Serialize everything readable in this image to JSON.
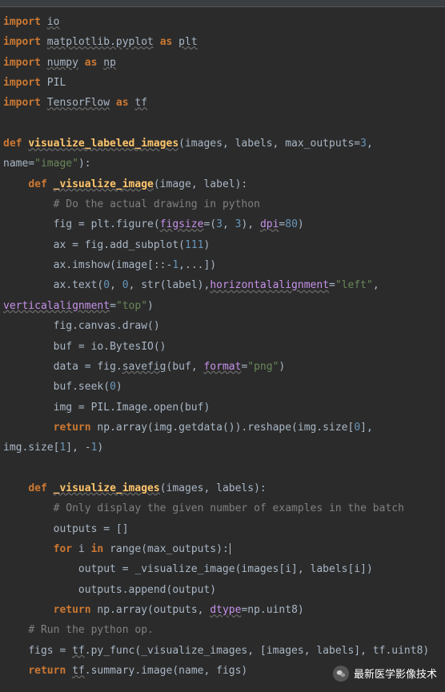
{
  "imports": [
    {
      "kw": "import",
      "module": "io"
    },
    {
      "kw": "import",
      "module": "matplotlib.pyplot",
      "as": "as",
      "alias": "plt"
    },
    {
      "kw": "import",
      "module": "numpy",
      "as": "as",
      "alias": "np"
    },
    {
      "kw": "import",
      "module": "PIL"
    },
    {
      "kw": "import",
      "module": "TensorFlow",
      "as": "as",
      "alias": "tf"
    }
  ],
  "def_kw": "def",
  "fn_outer": "visualize_labeled_images",
  "fn_outer_sig_1": "(images, labels, max_outputs=",
  "fn_outer_sig_num": "3",
  "fn_outer_sig_2": ", name=",
  "fn_outer_sig_str": "\"image\"",
  "fn_outer_sig_3": "):",
  "fn_inner1": "_visualize_image",
  "fn_inner1_sig": "(image, label):",
  "comment1": "# Do the actual drawing in python",
  "line_fig": {
    "pre": "fig = plt.figure(",
    "a1": "figsize",
    "eq": "=(",
    "n1": "3",
    "c1": ", ",
    "n2": "3",
    "p2": "), ",
    "a2": "dpi",
    "eq2": "=",
    "n3": "80",
    "end": ")"
  },
  "line_ax": {
    "pre": "ax = fig.add_subplot(",
    "n": "111",
    "end": ")"
  },
  "line_imshow": {
    "pre": "ax.imshow(image[::-",
    "n": "1",
    "end": ",...])"
  },
  "line_text": {
    "pre": "ax.text(",
    "n1": "0",
    "c1": ", ",
    "n2": "0",
    "c2": ", str(label),",
    "a1": "horizontalalignment",
    "eq1": "=",
    "s1": "\"left\"",
    "c3": ", ",
    "a2": "verticalalignment",
    "eq2": "=",
    "s2": "\"top\"",
    "end": ")"
  },
  "line_draw": "fig.canvas.draw()",
  "line_buf": "buf = io.BytesIO()",
  "line_savefig": {
    "pre": "data = fig.",
    "fn": "savefig",
    "mid": "(buf, ",
    "a": "format",
    "eq": "=",
    "s": "\"png\"",
    "end": ")"
  },
  "line_seek": {
    "pre": "buf.seek(",
    "n": "0",
    "end": ")"
  },
  "line_imgopen": "img = PIL.Image.open(buf)",
  "return_kw": "return",
  "line_ret1_a": " np.array(img.getdata()).reshape(img.size[",
  "line_ret1_n0": "0",
  "line_ret1_b": "], img.size[",
  "line_ret1_n1": "1",
  "line_ret1_c": "], -",
  "line_ret1_n2": "1",
  "line_ret1_d": ")",
  "fn_inner2": "_visualize_images",
  "fn_inner2_sig": "(images, labels):",
  "comment2": "# Only display the given number of examples in the batch",
  "line_outputs": "outputs = []",
  "for_kw": "for",
  "in_kw": "in",
  "line_for_a": " i ",
  "line_for_b": " range(max_outputs):",
  "line_call": "output = _visualize_image(images[i], labels[i])",
  "line_append": "outputs.append(output)",
  "line_ret2_a": " np.array(outputs, ",
  "line_ret2_arg": "dtype",
  "line_ret2_b": "=np.uint8)",
  "comment3": "# Run the python op.",
  "line_figs_a": "figs = ",
  "line_figs_tf": "tf",
  "line_figs_b": ".py_func(_visualize_images, [images, labels], tf.uint8)",
  "line_ret3_a": " ",
  "line_ret3_tf": "tf",
  "line_ret3_b": ".summary.image(name, figs)",
  "watermark": "最新医学影像技术"
}
